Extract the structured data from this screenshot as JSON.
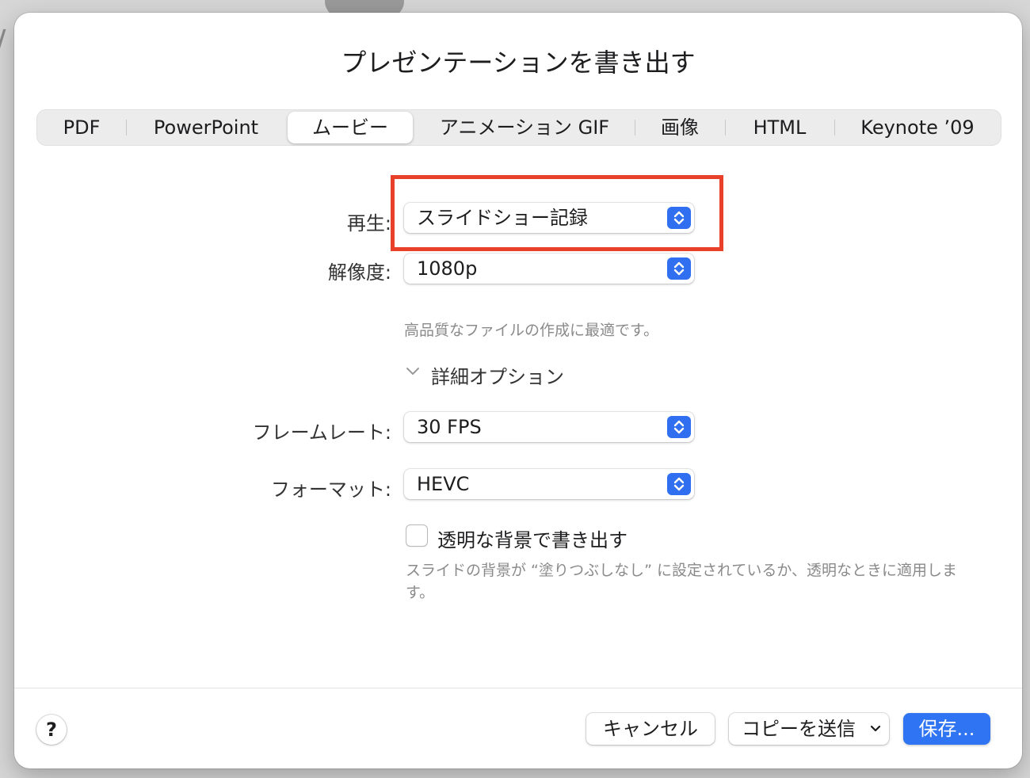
{
  "dialog": {
    "title": "プレゼンテーションを書き出す"
  },
  "tabs": [
    {
      "label": "PDF"
    },
    {
      "label": "PowerPoint"
    },
    {
      "label": "ムービー",
      "selected": true
    },
    {
      "label": "アニメーション GIF"
    },
    {
      "label": "画像"
    },
    {
      "label": "HTML"
    },
    {
      "label": "Keynote ’09"
    }
  ],
  "playback": {
    "label": "再生:",
    "value": "スライドショー記録"
  },
  "resolution": {
    "label": "解像度:",
    "value": "1080p",
    "hint": "高品質なファイルの作成に最適です。"
  },
  "advanced": {
    "label": "詳細オプション",
    "expanded": true
  },
  "framerate": {
    "label": "フレームレート:",
    "value": "30 FPS"
  },
  "format": {
    "label": "フォーマット:",
    "value": "HEVC"
  },
  "transparent": {
    "label": "透明な背景で書き出す",
    "checked": false,
    "note": "スライドの背景が “塗りつぶしなし” に設定されているか、透明なときに適用します。"
  },
  "footer": {
    "help": "?",
    "cancel": "キャンセル",
    "send_copy": "コピーを送信",
    "save": "保存..."
  },
  "colors": {
    "accent": "#2f74f2",
    "highlight": "#e8402a"
  }
}
